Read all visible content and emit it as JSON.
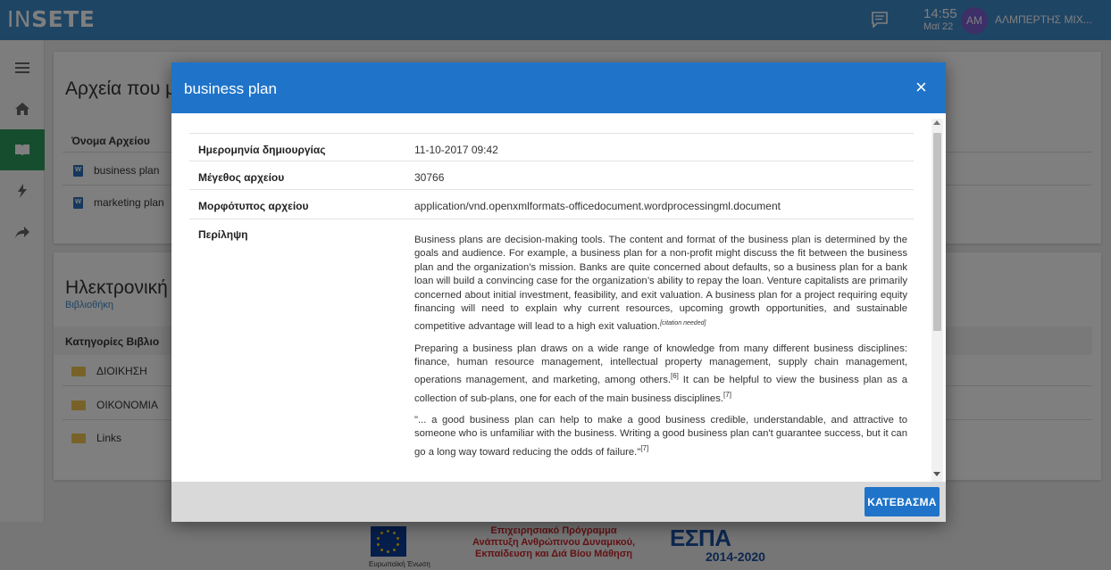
{
  "app": {
    "logo_prefix": "IN",
    "logo_suffix": "SETE"
  },
  "header": {
    "time": "14:55",
    "date": "Μαϊ 22",
    "avatar_initials": "AM",
    "user_name": "ΑΛΜΠΕΡΤΗΣ ΜΙΧ..."
  },
  "sidebar": {
    "items": [
      {
        "icon": "menu-icon"
      },
      {
        "icon": "home-icon"
      },
      {
        "icon": "book-icon",
        "active": true
      },
      {
        "icon": "bolt-icon"
      },
      {
        "icon": "share-arrow-icon"
      }
    ]
  },
  "files_section": {
    "title": "Αρχεία που μ",
    "column_header": "Όνομα Αρχείου",
    "files": [
      "business plan",
      "marketing plan"
    ]
  },
  "library_section": {
    "title": "Ηλεκτρονική",
    "subtitle": "Βιβλιοθήκη",
    "column_header": "Κατηγορίες Βιβλιο",
    "categories": [
      "ΔΙΟΙΚΗΣΗ",
      "ΟΙΚΟΝΟΜΙΑ",
      "Links"
    ]
  },
  "footer": {
    "eu_caption": "Ευρωπαϊκή Ένωση",
    "programme_lines": [
      "Επιχειρησιακό Πρόγραμμα",
      "Ανάπτυξη Ανθρώπινου Δυναμικού,",
      "Εκπαίδευση και Διά Βίου Μάθηση"
    ],
    "espa_title": "ΕΣΠΑ",
    "espa_years": "2014-2020"
  },
  "modal": {
    "title": "business plan",
    "close_symbol": "×",
    "fields": [
      {
        "label": "Ημερομηνία δημιουργίας",
        "value": "11-10-2017 09:42"
      },
      {
        "label": "Μέγεθος αρχείου",
        "value": "30766"
      },
      {
        "label": "Μορφότυπος αρχείου",
        "value": "application/vnd.openxmlformats-officedocument.wordprocessingml.document"
      }
    ],
    "summary_label": "Περίληψη",
    "summary": {
      "p1": "Business plans are decision-making tools. The content and format of the business plan is determined by the goals and audience. For example, a business plan for a non-profit might discuss the fit between the business plan and the organization’s mission. Banks are quite concerned about defaults, so a business plan for a bank loan will build a convincing case for the organization’s ability to repay the loan. Venture capitalists are primarily concerned about initial investment, feasibility, and exit valuation. A business plan for a project requiring equity financing will need to explain why current resources, upcoming growth opportunities, and sustainable competitive advantage will lead to a high exit valuation.",
      "p1_note": "[citation needed]",
      "p2": "Preparing a business plan draws on a wide range of knowledge from many different business disciplines: finance, human resource management, intellectual property management, supply chain management, operations management, and marketing, among others.",
      "p2_ref1": "[6]",
      "p2_mid": " It can be helpful to view the business plan as a collection of sub-plans, one for each of the main business disciplines.",
      "p2_ref2": "[7]",
      "p3": "\"... a good business plan can help to make a good business credible, understandable, and attractive to someone who is unfamiliar with the business. Writing a good business plan can't guarantee success, but it can go a long way toward reducing the odds of failure.\"",
      "p3_ref": "[7]"
    },
    "download_label": "ΚΑΤΕΒΑΣΜΑ"
  },
  "colors": {
    "brand_blue": "#1f74c9",
    "topbar": "#3f8ac8",
    "active_green": "#2e9a5e"
  }
}
